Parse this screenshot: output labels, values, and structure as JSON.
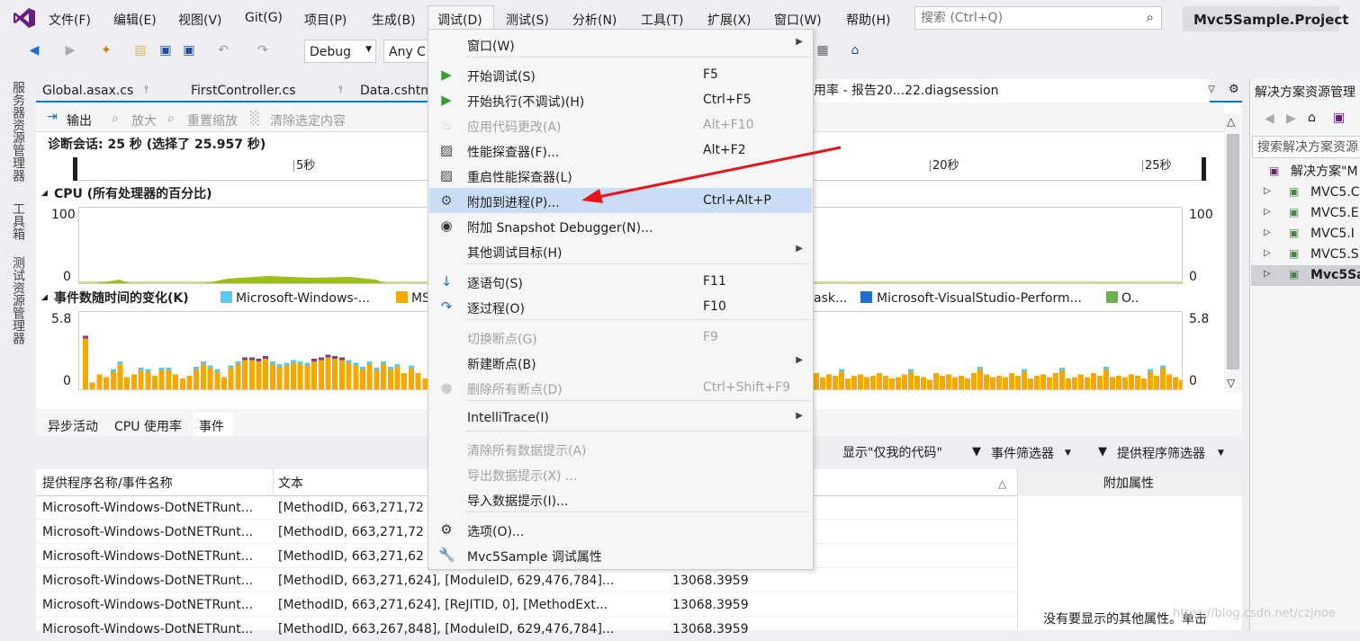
{
  "menubar": {
    "items": [
      "文件(F)",
      "编辑(E)",
      "视图(V)",
      "Git(G)",
      "项目(P)",
      "生成(B)",
      "调试(D)",
      "测试(S)",
      "分析(N)",
      "工具(T)",
      "扩展(X)",
      "窗口(W)",
      "帮助(H)"
    ],
    "search_placeholder": "搜索 (Ctrl+Q)",
    "project": "Mvc5Sample.Project"
  },
  "toolbar": {
    "config": "Debug",
    "platform": "Any C"
  },
  "sidetabs": [
    "服务器资源管理器",
    "工具箱",
    "测试资源管理器"
  ],
  "doctabs": [
    "Global.asax.cs",
    "FirstController.cs",
    "Data.cshtm",
    "用率 - 报告20...22.diagsession"
  ],
  "panel": {
    "tools": [
      "输出",
      "放大",
      "重置缩放",
      "清除选定内容"
    ],
    "session": "诊断会话: 25 秒 (选择了 25.957 秒)",
    "ruler": [
      "5秒",
      "20秒",
      "25秒"
    ],
    "cpu_title": "CPU (所有处理器的百分比)",
    "cpu_max": "100",
    "cpu_min": "0",
    "events_title": "事件数随时间的变化(K)",
    "events_max": "5.8",
    "events_min": "0",
    "legend": [
      {
        "label": "Microsoft-Windows-...",
        "color": "#5bc8f0"
      },
      {
        "label": "MS",
        "color": "#f7a800"
      },
      {
        "label": "ask...",
        "color": ""
      },
      {
        "label": "Microsoft-VisualStudio-Perform...",
        "color": "#1f6fd1"
      },
      {
        "label": "O..",
        "color": "#6ab04c"
      }
    ]
  },
  "bottom": {
    "tabs": [
      "异步活动",
      "CPU 使用率",
      "事件"
    ],
    "filters": [
      "显示\"仅我的代码\"",
      "事件筛选器",
      "提供程序筛选器"
    ],
    "columns": [
      "提供程序名称/事件名称",
      "文本",
      "附加属性"
    ],
    "rows": [
      {
        "provider": "Microsoft-Windows-DotNETRunt...",
        "text": "[MethodID, 663,271,72",
        "time": ""
      },
      {
        "provider": "Microsoft-Windows-DotNETRunt...",
        "text": "[MethodID, 663,271,72",
        "time": ""
      },
      {
        "provider": "Microsoft-Windows-DotNETRunt...",
        "text": "[MethodID, 663,271,62",
        "time": ""
      },
      {
        "provider": "Microsoft-Windows-DotNETRunt...",
        "text": "[MethodID, 663,271,624], [ModuleID, 629,476,784]...",
        "time": "13068.3959"
      },
      {
        "provider": "Microsoft-Windows-DotNETRunt...",
        "text": "[MethodID, 663,271,624], [ReJITID, 0], [MethodExt...",
        "time": "13068.3959"
      },
      {
        "provider": "Microsoft-Windows-DotNETRunt...",
        "text": "[MethodID, 663,267,848], [ModuleID, 629,476,784]...",
        "time": "13068.3959"
      }
    ],
    "props_empty": "没有要显示的其他属性。单击"
  },
  "solution": {
    "title": "解决方案资源管理",
    "search": "搜索解决方案资源",
    "items": [
      "解决方案\"M",
      "MVC5.C",
      "MVC5.E",
      "MVC5.I",
      "MVC5.S",
      "Mvc5Sa"
    ]
  },
  "menu": {
    "items": [
      {
        "label": "窗口(W)",
        "shortcut": "",
        "icon": "",
        "submenu": true,
        "disabled": false
      },
      {
        "label": "开始调试(S)",
        "shortcut": "F5",
        "icon": "play-icon",
        "submenu": false,
        "disabled": false
      },
      {
        "label": "开始执行(不调试)(H)",
        "shortcut": "Ctrl+F5",
        "icon": "play-outline-icon",
        "submenu": false,
        "disabled": false
      },
      {
        "label": "应用代码更改(A)",
        "shortcut": "Alt+F10",
        "icon": "hot-reload-icon",
        "submenu": false,
        "disabled": true
      },
      {
        "label": "性能探查器(F)...",
        "shortcut": "Alt+F2",
        "icon": "profiler-icon",
        "submenu": false,
        "disabled": false
      },
      {
        "label": "重启性能探查器(L)",
        "shortcut": "",
        "icon": "profiler-restart-icon",
        "submenu": false,
        "disabled": false
      },
      {
        "label": "附加到进程(P)...",
        "shortcut": "Ctrl+Alt+P",
        "icon": "attach-gear-icon",
        "submenu": false,
        "disabled": false
      },
      {
        "label": "附加 Snapshot Debugger(N)...",
        "shortcut": "",
        "icon": "camera-icon",
        "submenu": false,
        "disabled": false
      },
      {
        "label": "其他调试目标(H)",
        "shortcut": "",
        "icon": "",
        "submenu": true,
        "disabled": false
      },
      {
        "label": "逐语句(S)",
        "shortcut": "F11",
        "icon": "step-into-icon",
        "submenu": false,
        "disabled": false
      },
      {
        "label": "逐过程(O)",
        "shortcut": "F10",
        "icon": "step-over-icon",
        "submenu": false,
        "disabled": false
      },
      {
        "label": "切换断点(G)",
        "shortcut": "F9",
        "icon": "",
        "submenu": false,
        "disabled": true
      },
      {
        "label": "新建断点(B)",
        "shortcut": "",
        "icon": "",
        "submenu": true,
        "disabled": false
      },
      {
        "label": "删除所有断点(D)",
        "shortcut": "Ctrl+Shift+F9",
        "icon": "delete-breakpoints-icon",
        "submenu": false,
        "disabled": true
      },
      {
        "label": "IntelliTrace(I)",
        "shortcut": "",
        "icon": "",
        "submenu": true,
        "disabled": false
      },
      {
        "label": "清除所有数据提示(A)",
        "shortcut": "",
        "icon": "",
        "submenu": false,
        "disabled": true
      },
      {
        "label": "导出数据提示(X) ...",
        "shortcut": "",
        "icon": "",
        "submenu": false,
        "disabled": true
      },
      {
        "label": "导入数据提示(I)...",
        "shortcut": "",
        "icon": "",
        "submenu": false,
        "disabled": false
      },
      {
        "label": "选项(O)...",
        "shortcut": "",
        "icon": "gear-icon",
        "submenu": false,
        "disabled": false
      },
      {
        "label": "Mvc5Sample 调试属性",
        "shortcut": "",
        "icon": "wrench-icon",
        "submenu": false,
        "disabled": false
      }
    ],
    "highlighted": "附加到进程(P)..."
  },
  "watermark": "https://blog.csdn.net/czjnoe"
}
